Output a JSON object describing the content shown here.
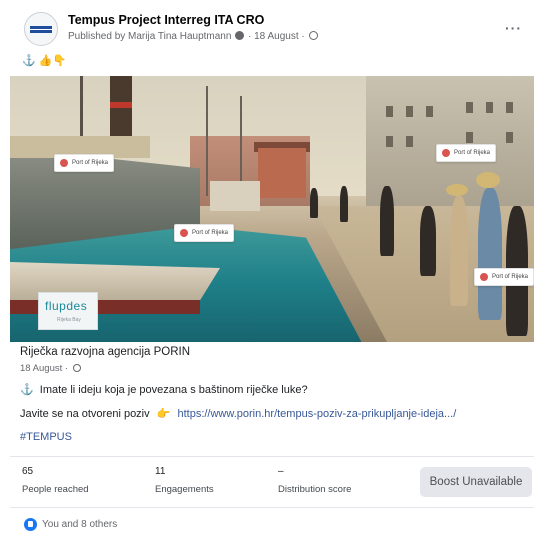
{
  "post": {
    "page_name": "Tempus Project Interreg ITA CRO",
    "published_by": "Published by Marija Tina Hauptmann",
    "date": "18 August",
    "more_label": "···",
    "emoji_line": "👍👇"
  },
  "image": {
    "labels": [
      "Port of Rijeka",
      "Port of Rijeka",
      "Port of Rijeka",
      "Port of Rijeka"
    ],
    "logo_text": "flupdes",
    "logo_sub": "Rijeka Bay"
  },
  "preview": {
    "source": "Riječka razvojna agencija PORIN",
    "date": "18 August",
    "line1": "Imate li ideju koja je povezana s baštinom riječke luke?",
    "line2_prefix": "Javite se na otvoreni poziv",
    "url": "https://www.porin.hr/tempus-poziv-za-prikupljanje-ideja.../",
    "hashtag": "#TEMPUS"
  },
  "stats": [
    {
      "value": "65",
      "label": "People reached"
    },
    {
      "value": "11",
      "label": "Engagements"
    },
    {
      "value": "–",
      "label": "Distribution score"
    }
  ],
  "boost_label": "Boost Unavailable",
  "reactions_text": "You and 8 others",
  "colors": {
    "link": "#385898",
    "like": "#1877f2",
    "water": "#1e7f88"
  }
}
